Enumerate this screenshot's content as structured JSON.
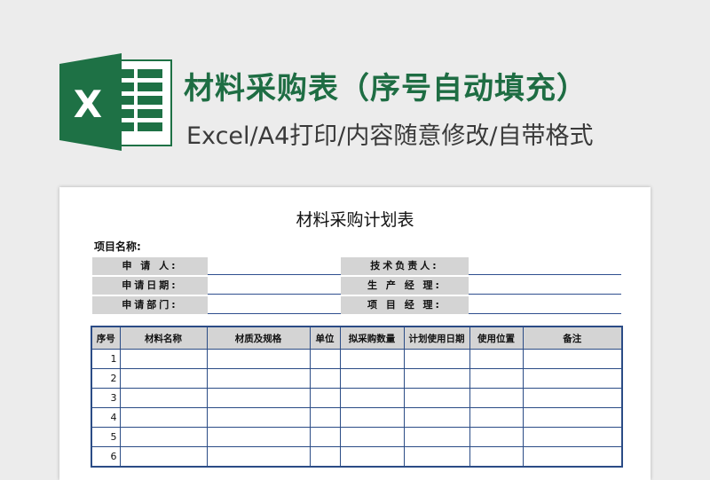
{
  "header": {
    "title": "材料采购表（序号自动填充）",
    "subtitle": "Excel/A4打印/内容随意修改/自带格式",
    "logo_letter": "X",
    "brand_color": "#1e6d43"
  },
  "sheet": {
    "title": "材料采购计划表",
    "project_label": "项目名称:",
    "left_fields": [
      "申 请 人:",
      "申请日期:",
      "申请部门:"
    ],
    "right_fields": [
      "技术负责人:",
      "生 产 经 理:",
      "项 目 经 理:"
    ],
    "columns": [
      "序号",
      "材料名称",
      "材质及规格",
      "单位",
      "拟采购数量",
      "计划使用日期",
      "使用位置",
      "备注"
    ],
    "row_numbers": [
      "1",
      "2",
      "3",
      "4",
      "5",
      "6"
    ],
    "grid_color": "#2b4c86"
  }
}
